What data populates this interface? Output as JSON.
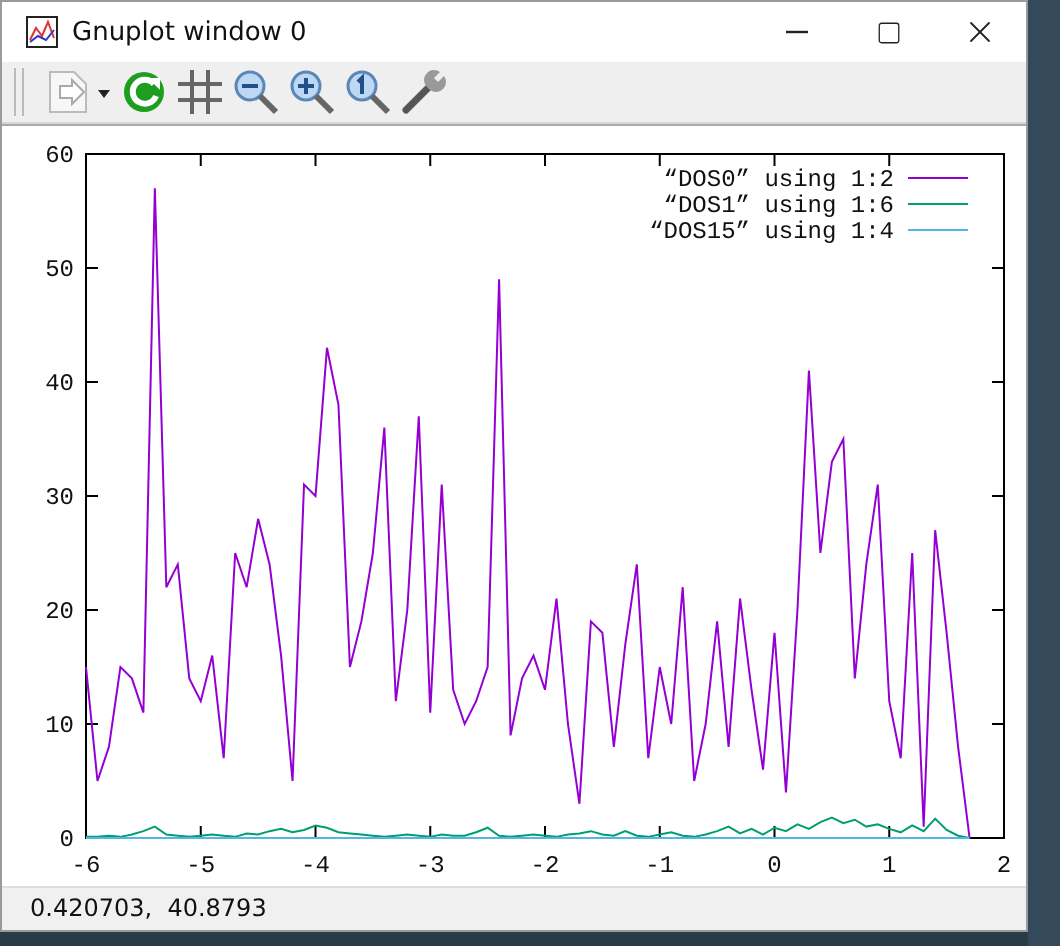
{
  "window": {
    "title": "Gnuplot window 0"
  },
  "toolbar": {
    "items": [
      {
        "kind": "copy"
      },
      {
        "kind": "replot"
      },
      {
        "kind": "grid"
      },
      {
        "kind": "zoom-out"
      },
      {
        "kind": "zoom-in"
      },
      {
        "kind": "zoom-reset"
      },
      {
        "kind": "options"
      }
    ]
  },
  "plot": {
    "chart_data": {
      "type": "line",
      "legend": "top right",
      "xlim": [
        -6,
        2
      ],
      "ylim": [
        0,
        60
      ],
      "xticks": [
        -6,
        -5,
        -4,
        -3,
        -2,
        -1,
        0,
        1,
        2
      ],
      "yticks": [
        0,
        10,
        20,
        30,
        40,
        50,
        60
      ],
      "x": [
        -6.0,
        -5.9,
        -5.8,
        -5.7,
        -5.6,
        -5.5,
        -5.4,
        -5.3,
        -5.2,
        -5.1,
        -5.0,
        -4.9,
        -4.8,
        -4.7,
        -4.6,
        -4.5,
        -4.4,
        -4.3,
        -4.2,
        -4.1,
        -4.0,
        -3.9,
        -3.8,
        -3.7,
        -3.6,
        -3.5,
        -3.4,
        -3.3,
        -3.2,
        -3.1,
        -3.0,
        -2.9,
        -2.8,
        -2.7,
        -2.6,
        -2.5,
        -2.4,
        -2.3,
        -2.2,
        -2.1,
        -2.0,
        -1.9,
        -1.8,
        -1.7,
        -1.6,
        -1.5,
        -1.4,
        -1.3,
        -1.2,
        -1.1,
        -1.0,
        -0.9,
        -0.8,
        -0.7,
        -0.6,
        -0.5,
        -0.4,
        -0.3,
        -0.2,
        -0.1,
        0.0,
        0.1,
        0.2,
        0.3,
        0.4,
        0.5,
        0.6,
        0.7,
        0.8,
        0.9,
        1.0,
        1.1,
        1.2,
        1.3,
        1.4,
        1.5,
        1.6,
        1.7
      ],
      "series": [
        {
          "name": "“DOS0” using 1:2",
          "color": "#9400d3",
          "values": [
            15,
            5,
            8,
            15,
            14,
            11,
            57,
            22,
            24,
            14,
            12,
            16,
            7,
            25,
            22,
            28,
            24,
            16,
            5,
            31,
            30,
            43,
            38,
            15,
            19,
            25,
            36,
            12,
            20,
            37,
            11,
            31,
            13,
            10,
            12,
            15,
            49,
            9,
            14,
            16,
            13,
            21,
            10,
            3,
            19,
            18,
            8,
            17,
            24,
            7,
            15,
            10,
            22,
            5,
            10,
            19,
            8,
            21,
            13,
            6,
            18,
            4,
            20,
            41,
            25,
            33,
            35,
            14,
            24,
            31,
            12,
            7,
            25,
            1,
            27,
            18,
            8,
            0
          ]
        },
        {
          "name": "“DOS1” using 1:6",
          "color": "#009e73",
          "values": [
            0.1,
            0.1,
            0.2,
            0.1,
            0.3,
            0.6,
            1.0,
            0.3,
            0.2,
            0.1,
            0.2,
            0.3,
            0.2,
            0.1,
            0.4,
            0.3,
            0.6,
            0.8,
            0.5,
            0.7,
            1.1,
            0.9,
            0.5,
            0.4,
            0.3,
            0.2,
            0.1,
            0.2,
            0.3,
            0.2,
            0.1,
            0.3,
            0.2,
            0.2,
            0.5,
            0.9,
            0.2,
            0.1,
            0.2,
            0.3,
            0.2,
            0.1,
            0.3,
            0.4,
            0.6,
            0.3,
            0.2,
            0.6,
            0.2,
            0.1,
            0.3,
            0.5,
            0.2,
            0.1,
            0.3,
            0.6,
            1.0,
            0.4,
            0.8,
            0.3,
            0.9,
            0.6,
            1.2,
            0.8,
            1.4,
            1.8,
            1.3,
            1.6,
            1.0,
            1.2,
            0.8,
            0.5,
            1.1,
            0.6,
            1.7,
            0.7,
            0.2,
            0.0
          ]
        },
        {
          "name": "“DOS15” using 1:4",
          "color": "#56b4e9",
          "values": [
            0,
            0,
            0,
            0,
            0,
            0,
            0,
            0,
            0,
            0,
            0,
            0,
            0,
            0,
            0,
            0,
            0,
            0,
            0,
            0,
            0,
            0,
            0,
            0,
            0,
            0,
            0,
            0,
            0,
            0,
            0,
            0,
            0,
            0,
            0,
            0,
            0,
            0,
            0,
            0,
            0,
            0,
            0,
            0,
            0,
            0,
            0,
            0,
            0,
            0,
            0,
            0,
            0,
            0,
            0,
            0,
            0,
            0,
            0,
            0,
            0,
            0,
            0,
            0,
            0,
            0,
            0,
            0,
            0,
            0,
            0,
            0,
            0,
            0,
            0,
            0,
            0,
            0
          ]
        }
      ]
    }
  },
  "status_bar": {
    "text": "0.420703,  40.8793"
  }
}
